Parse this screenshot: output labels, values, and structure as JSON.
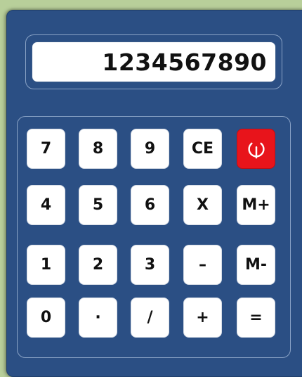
{
  "display": {
    "value": "1234567890"
  },
  "keys": {
    "k7": "7",
    "k8": "8",
    "k9": "9",
    "ce": "CE",
    "k4": "4",
    "k5": "5",
    "k6": "6",
    "mul": "X",
    "mplus": "M+",
    "k1": "1",
    "k2": "2",
    "k3": "3",
    "minus": "–",
    "mminus": "M-",
    "k0": "0",
    "dot": "·",
    "div": "/",
    "plus": "+",
    "eq": "="
  },
  "icons": {
    "power": "power-icon"
  },
  "colors": {
    "body": "#2b4f84",
    "power": "#e8141b",
    "background": "#b8cf9a"
  }
}
